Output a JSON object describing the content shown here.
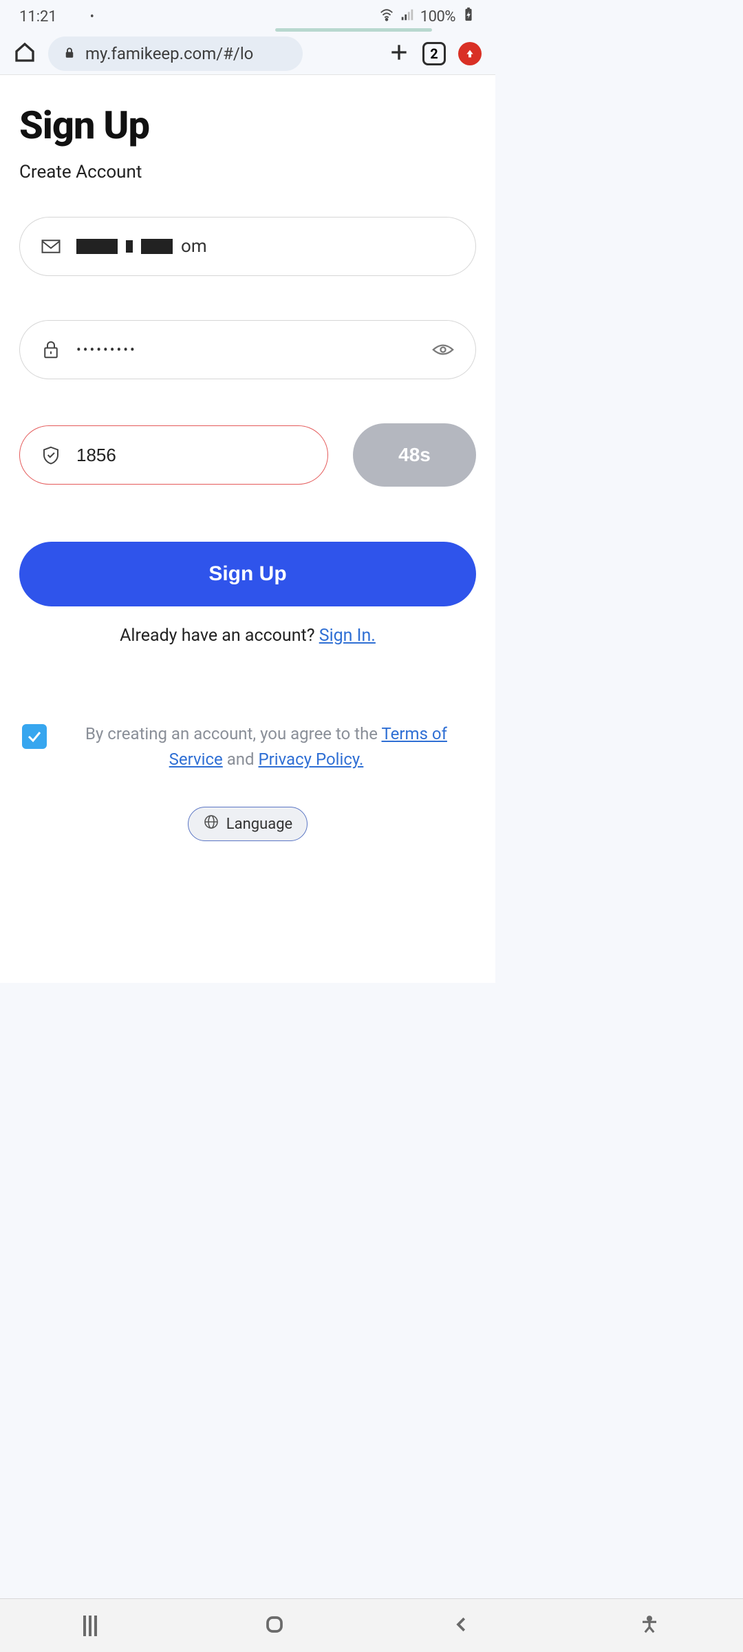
{
  "status": {
    "time": "11:21",
    "battery_pct": "100%",
    "notif_dot": "•"
  },
  "browser": {
    "url": "my.famikeep.com/#/lo",
    "tab_count": "2"
  },
  "page": {
    "title": "Sign Up",
    "subtitle": "Create Account",
    "email_value": "om",
    "password_value": "•••••••••",
    "code_value": "1856",
    "timer_label": "48s",
    "submit_label": "Sign Up",
    "already_text": "Already have an account? ",
    "signin_link": "Sign In.",
    "agree_prefix": "By creating an account, you agree to the ",
    "tos": "Terms of Service",
    "agree_and": " and ",
    "privacy": "Privacy Policy.",
    "language_label": "Language"
  }
}
